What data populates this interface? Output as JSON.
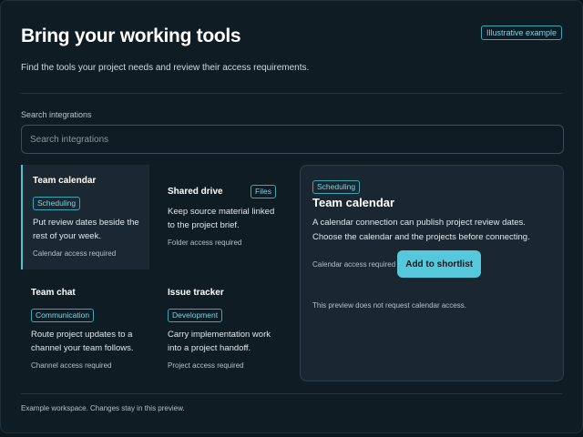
{
  "header": {
    "title": "Bring your working tools",
    "tag": "Illustrative example",
    "subtitle": "Find the tools your project needs and review their access requirements."
  },
  "search": {
    "label": "Search integrations",
    "placeholder": "Search integrations",
    "value": ""
  },
  "cards": [
    {
      "title": "Team calendar",
      "chip": "Scheduling",
      "desc": "Put review dates beside the rest of your week.",
      "access": "Calendar access required",
      "selected": true
    },
    {
      "title": "Shared drive",
      "chip": "Files",
      "desc": "Keep source material linked to the project brief.",
      "access": "Folder access required"
    },
    {
      "title": "Team chat",
      "chip": "Communication",
      "desc": "Route project updates to a channel your team follows.",
      "access": "Channel access required"
    },
    {
      "title": "Issue tracker",
      "chip": "Development",
      "desc": "Carry implementation work into a project handoff.",
      "access": "Project access required"
    }
  ],
  "detail": {
    "chip": "Scheduling",
    "title": "Team calendar",
    "desc": "A calendar connection can publish project review dates. Choose the calendar and the projects before connecting.",
    "access": "Calendar access required",
    "button": "Add to shortlist",
    "note": "This preview does not request calendar access."
  },
  "footer": {
    "text": "Example workspace. Changes stay in this preview."
  },
  "colors": {
    "background": "#101c24",
    "accent": "#56c8dc",
    "chip_border": "#3aa7b8"
  }
}
